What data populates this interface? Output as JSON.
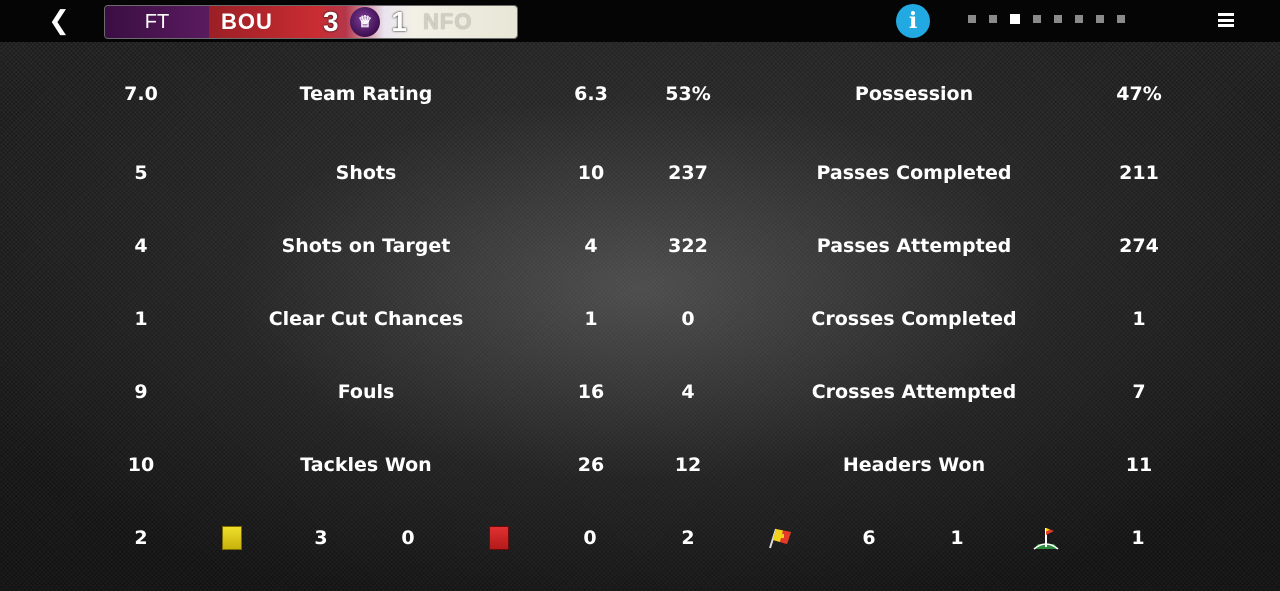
{
  "header": {
    "status": "FT",
    "home_team": "BOU",
    "home_score": "3",
    "away_score": "1",
    "away_team": "NFO",
    "info_icon": "info-icon",
    "back_icon": "chevron-left-icon",
    "menu_icon": "hamburger-menu-icon",
    "pager_pages": 8,
    "pager_active": 3
  },
  "left_stats": [
    {
      "label": "Team Rating",
      "home": "7.0",
      "away": "6.3"
    },
    {
      "label": "Shots",
      "home": "5",
      "away": "10"
    },
    {
      "label": "Shots on Target",
      "home": "4",
      "away": "4"
    },
    {
      "label": "Clear Cut Chances",
      "home": "1",
      "away": "1"
    },
    {
      "label": "Fouls",
      "home": "9",
      "away": "16"
    },
    {
      "label": "Tackles Won",
      "home": "10",
      "away": "26"
    }
  ],
  "right_stats": [
    {
      "label": "Possession",
      "home": "53%",
      "away": "47%"
    },
    {
      "label": "Passes Completed",
      "home": "237",
      "away": "211"
    },
    {
      "label": "Passes Attempted",
      "home": "322",
      "away": "274"
    },
    {
      "label": "Crosses Completed",
      "home": "0",
      "away": "1"
    },
    {
      "label": "Crosses Attempted",
      "home": "4",
      "away": "7"
    },
    {
      "label": "Headers Won",
      "home": "12",
      "away": "11"
    }
  ],
  "bottom_row": {
    "yellow_home": "2",
    "yellow_away": "3",
    "red_home": "0",
    "red_away": "0",
    "offside_home": "2",
    "offside_away": "6",
    "corner_home": "1",
    "corner_away": "1"
  },
  "colors": {
    "ft_bg": "#4a1452",
    "home_bg": "#c92d32",
    "away_bg": "#f3f0e6",
    "info_blue": "#23a9e1"
  }
}
